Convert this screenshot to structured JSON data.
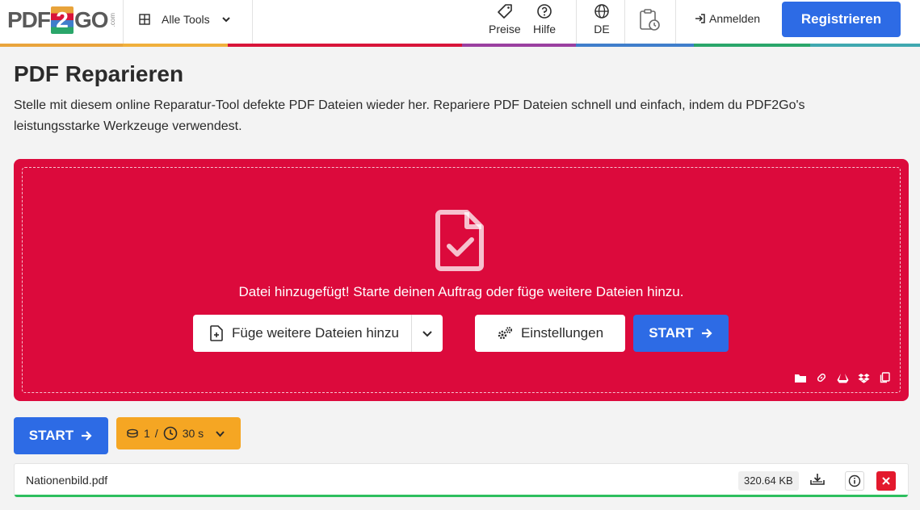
{
  "header": {
    "logo": {
      "left": "PDF",
      "middle": "2",
      "right": "GO",
      "suffix": ".com"
    },
    "all_tools_label": "Alle Tools",
    "nav": {
      "prices_label": "Preise",
      "help_label": "Hilfe",
      "language_label": "DE"
    },
    "login_label": "Anmelden",
    "register_label": "Registrieren"
  },
  "colors": {
    "accent_blue": "#2d6be5",
    "drop_red": "#dc0a3c",
    "credit_orange": "#f5a623",
    "progress_green": "#2dbf5e",
    "delete_red": "#e3192d"
  },
  "page": {
    "title": "PDF Reparieren",
    "description": "Stelle mit diesem online Reparatur-Tool defekte PDF Dateien wieder her. Repariere PDF Dateien schnell und einfach, indem du PDF2Go's leistungsstarke Werkzeuge verwendest."
  },
  "dropzone": {
    "message": "Datei hinzugefügt! Starte deinen Auftrag oder füge weitere Dateien hinzu.",
    "add_files_label": "Füge weitere Dateien hinzu",
    "settings_label": "Einstellungen",
    "start_label": "START",
    "source_icons": [
      "folder-icon",
      "link-icon",
      "google-drive-icon",
      "dropbox-icon",
      "clipboard-icon"
    ]
  },
  "controls": {
    "start_label": "START",
    "credits": {
      "count": "1",
      "slash": "/",
      "time": "30 s"
    }
  },
  "file": {
    "name": "Nationenbild.pdf",
    "size": "320.64 KB",
    "progress_percent": 100
  }
}
